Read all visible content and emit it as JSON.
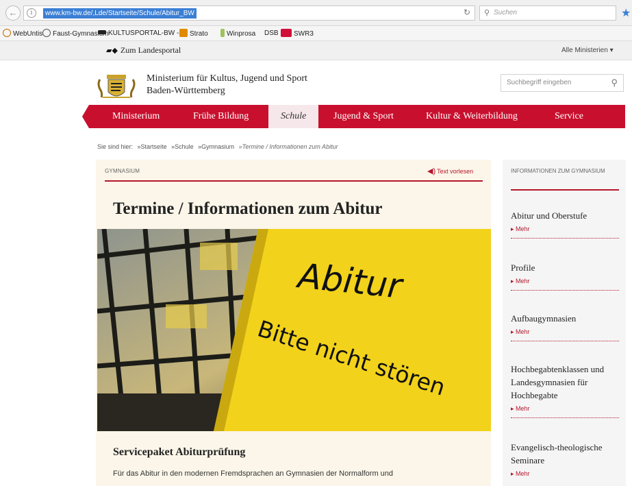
{
  "browser": {
    "url": "www.km-bw.de/,Lde/Startseite/Schule/Abitur_BW",
    "search_placeholder": "Suchen",
    "bookmarks": [
      "WebUntis",
      "Faust-Gymnasium",
      "KULTUSPORTAL-BW - ...",
      "Strato",
      "Winprosa",
      "DSB",
      "SWR3"
    ]
  },
  "topstrip": {
    "landesportal": "Zum Landesportal",
    "ministerien": "Alle Ministerien ▾"
  },
  "header": {
    "ministry_line1": "Ministerium für Kultus, Jugend und Sport",
    "ministry_line2": "Baden-Württemberg",
    "search_placeholder": "Suchbegriff eingeben"
  },
  "nav": {
    "items": [
      "Ministerium",
      "Frühe Bildung",
      "Schule",
      "Jugend & Sport",
      "Kultur & Weiterbildung",
      "Service"
    ],
    "active": "Schule"
  },
  "breadcrumb": {
    "prefix": "Sie sind hier:",
    "items": [
      "»Startseite",
      "»Schule",
      "»Gymnasium",
      "»Termine / Informationen zum Abitur"
    ]
  },
  "main": {
    "section_label": "GYMNASIUM",
    "read_aloud": "Text vorlesen",
    "title": "Termine / Informationen zum Abitur",
    "hero_text1": "Abitur",
    "hero_text2": "Bitte nicht stören",
    "subheading": "Servicepaket Abiturprüfung",
    "body_text": "Für das Abitur in den modernen Fremdsprachen  an Gymnasien der Normalform und"
  },
  "sidebar": {
    "heading": "INFORMATIONEN ZUM GYMNASIUM",
    "more_label": "▸ Mehr",
    "items": [
      "Abitur und Oberstufe",
      "Profile",
      "Aufbaugymnasien",
      "Hochbegabtenklassen und Landesgymnasien für Hochbegabte",
      "Evangelisch-theologische Seminare"
    ]
  },
  "colors": {
    "brand_red": "#c8102e",
    "link_red": "#b5162b",
    "hero_yellow": "#f2d21b",
    "content_bg": "#fbf6e9"
  }
}
